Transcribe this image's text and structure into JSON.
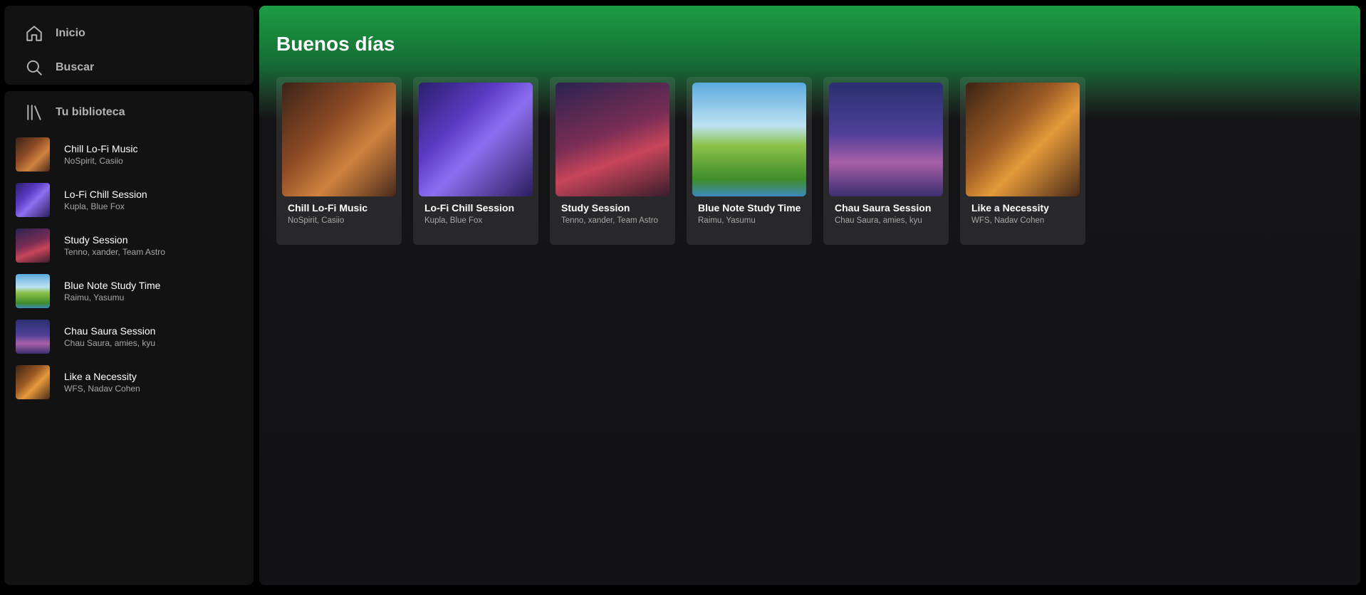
{
  "nav": {
    "home_label": "Inicio",
    "search_label": "Buscar"
  },
  "library": {
    "title": "Tu biblioteca",
    "items": [
      {
        "title": "Chill Lo-Fi Music",
        "subtitle": "NoSpirit, Casiio"
      },
      {
        "title": "Lo-Fi Chill Session",
        "subtitle": "Kupla, Blue Fox"
      },
      {
        "title": "Study Session",
        "subtitle": "Tenno, xander, Team Astro"
      },
      {
        "title": "Blue Note Study Time",
        "subtitle": "Raimu, Yasumu"
      },
      {
        "title": "Chau Saura Session",
        "subtitle": "Chau Saura, amies, kyu"
      },
      {
        "title": "Like a Necessity",
        "subtitle": "WFS, Nadav Cohen"
      }
    ]
  },
  "main": {
    "greeting": "Buenos días",
    "cards": [
      {
        "title": "Chill Lo-Fi Music",
        "subtitle": "NoSpirit, Casiio"
      },
      {
        "title": "Lo-Fi Chill Session",
        "subtitle": "Kupla, Blue Fox"
      },
      {
        "title": "Study Session",
        "subtitle": "Tenno, xander, Team Astro"
      },
      {
        "title": "Blue Note Study Time",
        "subtitle": "Raimu, Yasumu"
      },
      {
        "title": "Chau Saura Session",
        "subtitle": "Chau Saura, amies, kyu"
      },
      {
        "title": "Like a Necessity",
        "subtitle": "WFS, Nadav Cohen"
      }
    ]
  },
  "colors": {
    "accent_green": "#1d9c45",
    "panel_bg": "#121212",
    "muted_text": "#a7a7a7"
  }
}
